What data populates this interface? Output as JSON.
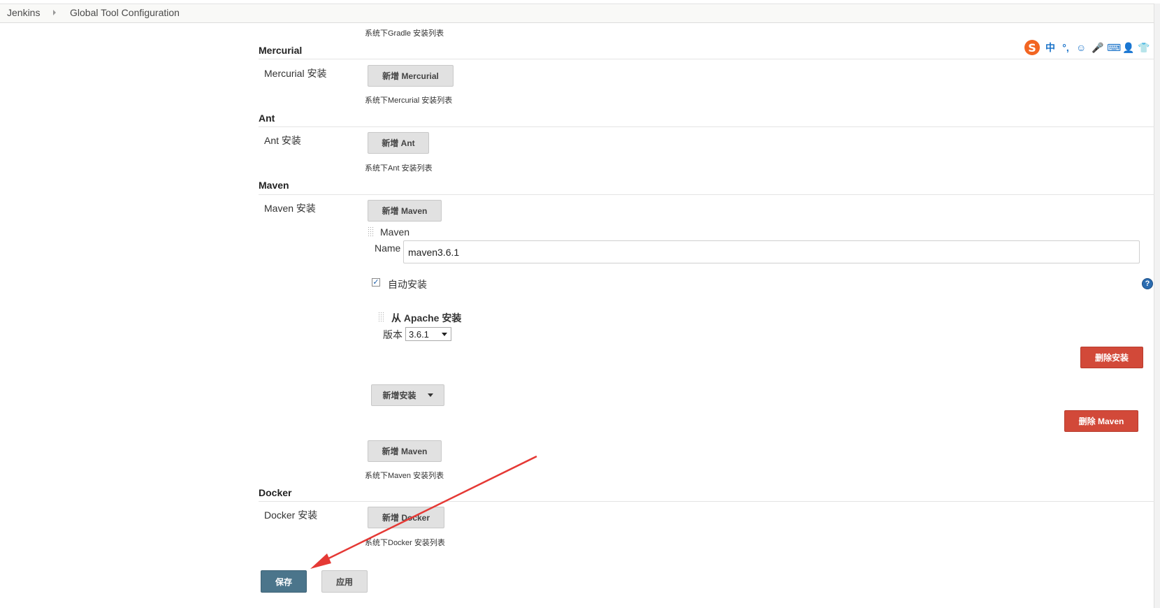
{
  "breadcrumb": {
    "home": "Jenkins",
    "current": "Global Tool Configuration"
  },
  "gradle": {
    "list_desc": "系统下Gradle 安装列表"
  },
  "mercurial": {
    "title": "Mercurial",
    "label": "Mercurial 安装",
    "add_button": "新增 Mercurial",
    "list_desc": "系统下Mercurial 安装列表"
  },
  "ant": {
    "title": "Ant",
    "label": "Ant 安装",
    "add_button": "新增 Ant",
    "list_desc": "系统下Ant 安装列表"
  },
  "maven": {
    "title": "Maven",
    "label": "Maven 安装",
    "add_button_top": "新增 Maven",
    "item_title": "Maven",
    "name_label": "Name",
    "name_value": "maven3.6.1",
    "auto_install_label": "自动安装",
    "auto_install_checked": true,
    "installer_title": "从 Apache 安装",
    "version_label": "版本",
    "version_value": "3.6.1",
    "delete_installer_button": "删除安装",
    "add_installer_button": "新增安装",
    "delete_maven_button": "删除 Maven",
    "add_button_bottom": "新增 Maven",
    "list_desc": "系统下Maven 安装列表"
  },
  "docker": {
    "title": "Docker",
    "label": "Docker 安装",
    "add_button": "新增 Docker",
    "list_desc": "系统下Docker 安装列表"
  },
  "footer": {
    "save_button": "保存",
    "apply_button": "应用"
  },
  "ime_toolbar": {
    "logo": "S",
    "items": [
      "中",
      "°,",
      "☺",
      "🎤",
      "⌨",
      "👤",
      "👕"
    ]
  },
  "colors": {
    "save_blue": "#4b758b",
    "delete_red": "#d24939",
    "arrow_red": "#e53935"
  }
}
